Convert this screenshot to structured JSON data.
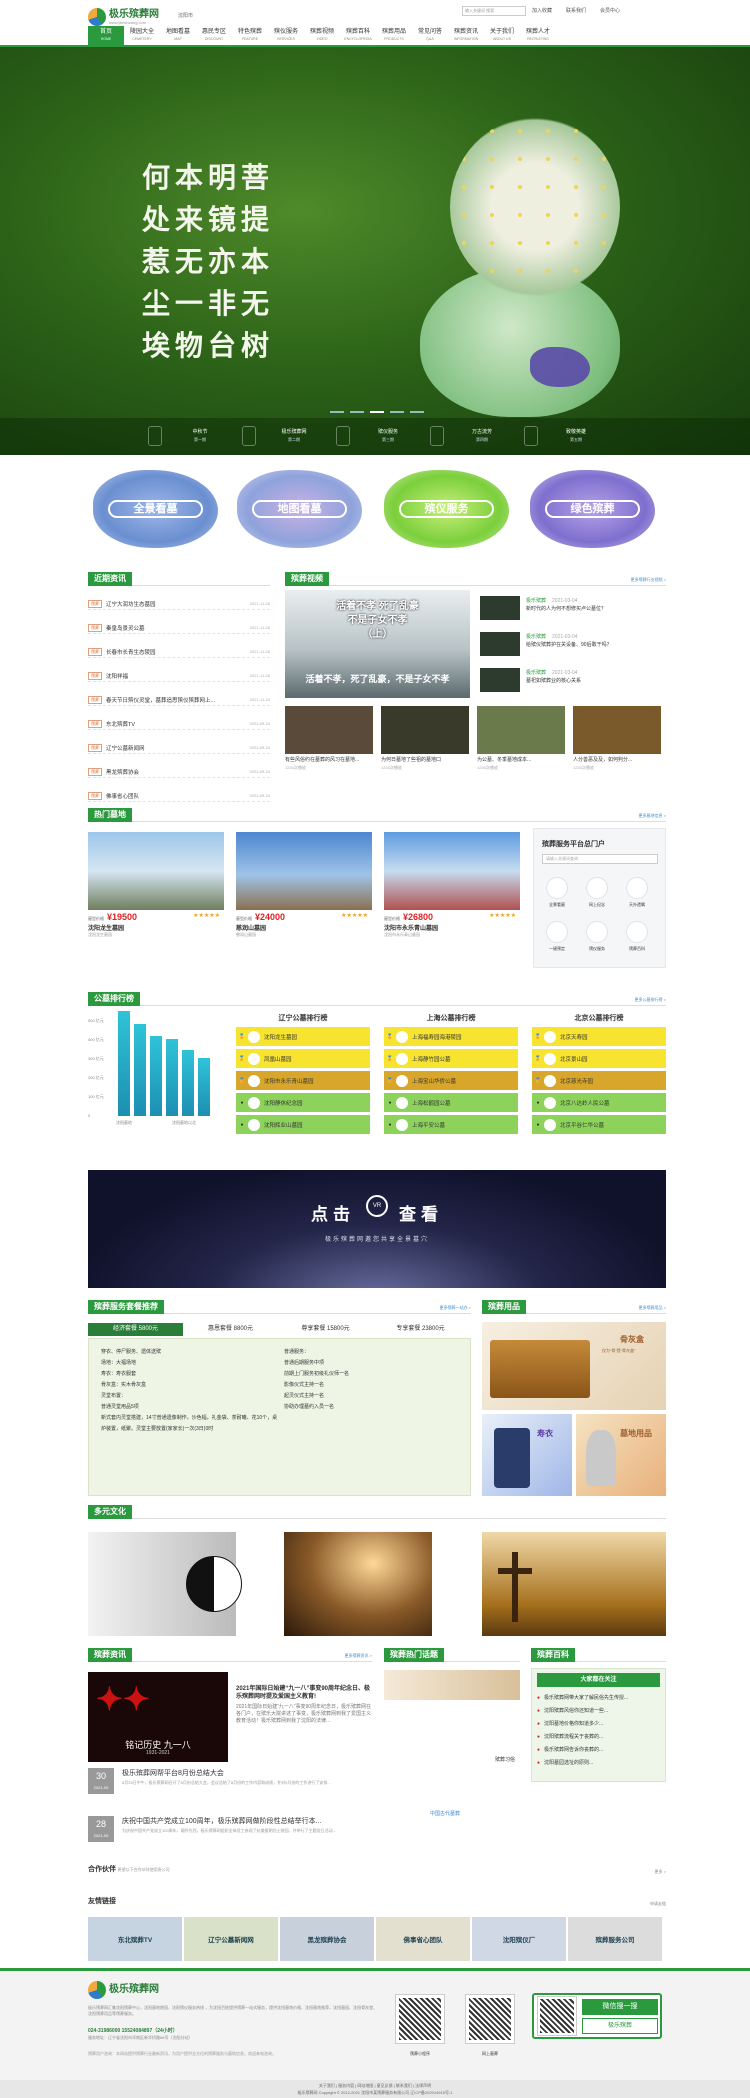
{
  "header": {
    "brand": "极乐殡葬网",
    "brand_url": "www.jilebinzang.com",
    "city": "沈阳市",
    "search_placeholder": "输入关键词  搜索",
    "links": [
      "加入收藏",
      "联系我们",
      "会员中心"
    ],
    "nav": [
      {
        "cn": "首页",
        "en": "HOME"
      },
      {
        "cn": "陵园大全",
        "en": "CEMETERY"
      },
      {
        "cn": "地图看墓",
        "en": "MAP"
      },
      {
        "cn": "惠民专区",
        "en": "DISCOUNT"
      },
      {
        "cn": "特色殡葬",
        "en": "FEATURE"
      },
      {
        "cn": "殡仪服务",
        "en": "SERVICES"
      },
      {
        "cn": "殡葬视频",
        "en": "VIDEO"
      },
      {
        "cn": "殡葬百科",
        "en": "ENCYCLOPEDIA"
      },
      {
        "cn": "殡葬用品",
        "en": "PRODUCTS"
      },
      {
        "cn": "常见问答",
        "en": "Q&A"
      },
      {
        "cn": "殡葬资讯",
        "en": "INFORMATION"
      },
      {
        "cn": "关于我们",
        "en": "ABOUT US"
      },
      {
        "cn": "殡葬人才",
        "en": "RECRUITING"
      }
    ]
  },
  "hero": {
    "poem": [
      "何本明菩",
      "处来镜提",
      "惹无亦本",
      "尘一非无",
      "埃物台树"
    ],
    "festivals": [
      {
        "name": "中秋节",
        "note": "第一期"
      },
      {
        "name": "极乐殡葬网",
        "note": "第二期"
      },
      {
        "name": "殡仪服务",
        "note": "第三期"
      },
      {
        "name": "万古流芳",
        "note": "第四期"
      },
      {
        "name": "致敬英雄",
        "note": "第五期"
      }
    ]
  },
  "quick": [
    "全景看墓",
    "地图看墓",
    "殡仪服务",
    "绿色殡葬"
  ],
  "news": {
    "title": "近期资讯",
    "tag": "殡葬",
    "items": [
      {
        "t": "辽宁大润坊生态墓园",
        "d": "2021-11-26"
      },
      {
        "t": "秦皇岛景灵公墓",
        "d": "2021-11-26"
      },
      {
        "t": "长春市长青生态陵园",
        "d": "2021-11-26"
      },
      {
        "t": "沈阳祥福",
        "d": "2021-11-26"
      },
      {
        "t": "春天节日殡仪灵堂，墓葬追思殡仪殡葬网上...",
        "d": "2021-11-24"
      },
      {
        "t": "东北殡葬TV",
        "d": "2021-09-24"
      },
      {
        "t": "辽宁公墓新闻网",
        "d": "2021-09-24"
      },
      {
        "t": "黑龙殡葬协会",
        "d": "2021-09-24"
      },
      {
        "t": "佛事省心团队",
        "d": "2021-09-24"
      }
    ]
  },
  "video": {
    "title": "殡葬视频",
    "more": "更多殡葬行业视频 >",
    "main_caption": [
      "活着不孝 死了乱豪",
      "不是子女不孝",
      "（上）"
    ],
    "main_sub": "活着不孝，死了乱豪，不是子女不孝",
    "side": [
      {
        "tag": "极乐殡葬",
        "d": "2021-03-04",
        "t": "新时代的人为何不想修买卢公墓位？"
      },
      {
        "tag": "极乐殡葬",
        "d": "2021-03-04",
        "t": "给殡仪殡葬护在关设备、90后敢干吗？"
      },
      {
        "tag": "极乐殡葬",
        "d": "2021-03-04",
        "t": "墓祀如殡葬业的核心关系"
      }
    ],
    "thumbs": [
      {
        "t": "有些风俗约在墓葬的风习在墓地...",
        "v": "1234次播放"
      },
      {
        "t": "为何日墓地了些祖的墓地口",
        "v": "1234次播放"
      },
      {
        "t": "为公墓、冬季墓地成本...",
        "v": "1234次播放"
      },
      {
        "t": "人分善恶及及，如何判分...",
        "v": "1234次播放"
      }
    ]
  },
  "cemetery": {
    "title": "热门墓地",
    "more": "更多墓地信息 >",
    "label": "墓型价格",
    "items": [
      {
        "p": "¥19500",
        "n": "沈阳龙生墓园",
        "s": "★★★★★"
      },
      {
        "p": "¥24000",
        "n": "慈润山墓园",
        "s": "★★★★★"
      },
      {
        "p": "¥26800",
        "n": "沈阳市永乐青山墓园",
        "s": "★★★★★"
      }
    ],
    "portal": {
      "title": "殡葬服务平台总门户",
      "search": "请输入关键词查询",
      "items": [
        "全景看墓",
        "网上纪念",
        "天外遗嘱",
        "一键预定",
        "殡仪服务",
        "殡葬百科"
      ]
    }
  },
  "rank": {
    "title": "公墓排行榜",
    "more": "更多公墓排行榜 >",
    "yaxis": [
      "500 亿元",
      "400 亿元",
      "300 亿元",
      "200 亿元",
      "100 亿元",
      "0"
    ],
    "xlabels": [
      "沈阳墓地",
      "沈阳墓地以北"
    ],
    "cols": [
      {
        "h": "辽宁公墓排行榜",
        "r": [
          "沈阳龙生墓园",
          "凤凰山墓园",
          "沈阳市永乐青山墓园",
          "沈阳静休纪念园",
          "沈阳辉业山墓园"
        ]
      },
      {
        "h": "上海公墓排行榜",
        "r": [
          "上海福寿园海港陵园",
          "上海静竹园公墓",
          "上海宝山华侨公墓",
          "上海松鹤园公墓",
          "上海平安公墓"
        ]
      },
      {
        "h": "北京公墓排行榜",
        "r": [
          "北京天寿园",
          "北京景山园",
          "北京慈光寺园",
          "北京八达岭人民公墓",
          "北京平谷仁华公墓"
        ]
      }
    ]
  },
  "vr": {
    "head": "点击",
    "tail": "查看",
    "badge": "VR",
    "sub": "极乐殡葬网邀您共享全景墓穴"
  },
  "package": {
    "title": "殡葬服务套餐推荐",
    "more": "更多殡葬一站办 >",
    "tabs": [
      "经济套餐 5800元",
      "惠恩套餐 8800元",
      "尊享套餐 15800元",
      "专享套餐 23800元"
    ],
    "left": [
      "穿衣、停尸服务、遗体送殡",
      "场地：大福场地",
      "寿衣：寿衣服套",
      "骨灰盒：实木骨灰盒",
      "灵堂布置：",
      "普通灵堂用品5项",
      "新式套内灵堂搭建，14寸普通遗像制作，沙色幅，礼金袋、茶耐曦、花10个，桌炉装置，纸聚。灵堂主要放置(家家长)一次(3日)0时"
    ],
    "right": [
      "普通服务：",
      "普通后期服务中项",
      "前期上门服务初级礼仪师一名",
      "影像仪式主持一名",
      "起灵仪式主持一名",
      "协助办理墓约入员一名"
    ]
  },
  "goods": {
    "title": "殡葬用品",
    "more": "更多殡葬用品 >",
    "items": [
      "骨灰盒",
      "寿衣",
      "墓地用品"
    ],
    "note": "仅为“骨”提“骨灰盒”"
  },
  "culture": {
    "title": "多元文化"
  },
  "binfo": {
    "title": "殡葬资讯",
    "more": "更多殡葬资讯 >",
    "head": "2021年国际日始建“九一八”事变90周年纪念日、极乐殡葬网时提及爱国主义教育!",
    "headtext": "2021年国际日始建“九一八”事变90周年纪念日，极乐殡葬网在各门户，在殡乐大院讲述了事变，极乐殡葬网到我了爱国主义教育活动！极乐殡葬网到我了沈阳的法律...",
    "imgtext": "铭记历史 九一八",
    "imgyear": "1931-2021",
    "list": [
      {
        "d": "30",
        "m": "2021-09",
        "t": "极乐殡葬网帮平台8月份总结大会",
        "x": "8月25日中午，极乐殡葬网召开了8月份总结大会。会议总结了8月份的工作内容和成绩，并对9月份的工作进行了安排..."
      },
      {
        "d": "28",
        "m": "2021-09",
        "t": "庆祝中国共产党成立100周年，极乐殡葬网做阶段性总结举行本...",
        "x": "为庆祝中国共产党成立100周年，缅怀先烈，极乐殡葬网组织全体员工参观了抗美援朝烈士陵园，并举行了主题党日活动..."
      }
    ]
  },
  "hot": {
    "title": "殡葬热门话题",
    "items": [
      "殡葬习俗",
      "中国古代墓葬"
    ]
  },
  "baike": {
    "title": "殡葬百科",
    "box": "大家都在关注",
    "items": [
      "极乐殡葬网带大家了解民俗先生传授...",
      "沈阳殡葬风俗你还知道一些...",
      "沈阳墓地价格你知道多少...",
      "沈阳殡葬流程关于丧葬的...",
      "极乐殡葬网告诉你丧葬的...",
      "沈阳墓园选址的原则..."
    ]
  },
  "partner": {
    "title": "合作伙伴",
    "sub": "希望以下合作伙伴使用贵公司",
    "more": "更多 >"
  },
  "links": {
    "title": "友情链接",
    "more": "申请友链",
    "items": [
      "东北殡葬TV",
      "辽宁公墓新闻网",
      "黑龙殡葬协会",
      "佛事省心团队",
      "沈阳殡仪厂",
      "殡葬服务公司"
    ]
  },
  "footer": {
    "brand": "极乐殡葬网",
    "intro": "极乐殡葬网汇集沈阳殡葬中心，沈阳墓地陵园、沈阳殡仪服务热线 ，为沈阳百姓提供殡葬一站式服务，提供沈阳墓地价格、沈阳墓地推荐，沈阳墓园、沈阳骨灰堂、沈阳殡葬用品等殡葬服务。",
    "phone": "024-31986000  15524084897（24小时）",
    "addr": "服务地址：辽宁省沈阳市浑南区新华桥路68号（沈阳分站）",
    "note": "殡葬用户咨询：本网站提供殡葬行业最新资讯，为用户提供全方位的殡葬服务与墓地信息，欢迎来电咨询。",
    "qr": [
      "殡葬小程序",
      "网上墓葬"
    ],
    "wx": "微信搜一搜",
    "wxs": "极乐殡葬",
    "bottom": [
      "关于我们 | 服务内容 | 网站地图 | 意见反馈 | 联系我们 | 法律声明",
      "极乐殡葬网 Copyright © 2012-2021 沈阳市某殡葬服务有限公司 辽ICP备202014915号-1"
    ]
  }
}
